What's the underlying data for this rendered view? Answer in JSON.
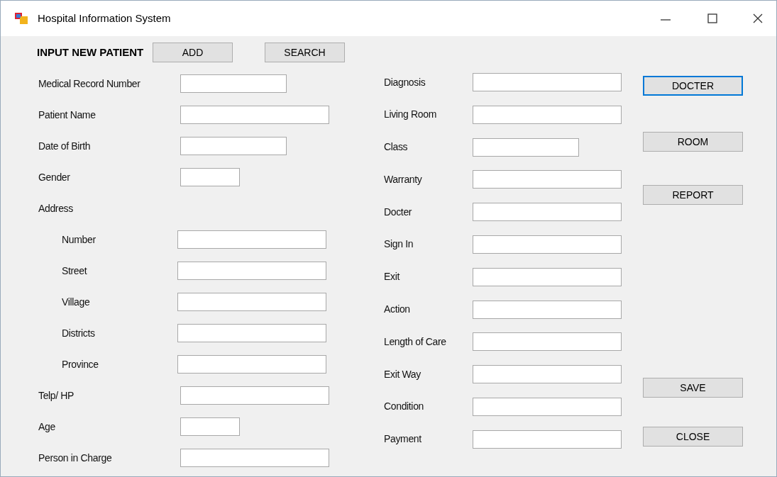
{
  "window": {
    "title": "Hospital Information System"
  },
  "header": {
    "title": "INPUT NEW PATIENT",
    "buttons": [
      "ADD",
      "SEARCH"
    ]
  },
  "left_fields": [
    {
      "label": "Medical Record Number",
      "kind": "medium"
    },
    {
      "label": "Patient Name",
      "kind": "wide"
    },
    {
      "label": "Date of Birth",
      "kind": "medium"
    },
    {
      "label": "Gender",
      "kind": "small"
    },
    {
      "label": "Address",
      "kind": "heading",
      "children": [
        {
          "label": "Number",
          "kind": "wide"
        },
        {
          "label": "Street",
          "kind": "wide"
        },
        {
          "label": "Village",
          "kind": "wide"
        },
        {
          "label": "Districts",
          "kind": "wide"
        },
        {
          "label": "Province",
          "kind": "wide"
        }
      ]
    },
    {
      "label": "Telp/ HP",
      "kind": "wide"
    },
    {
      "label": "Age",
      "kind": "small"
    },
    {
      "label": "Person in Charge",
      "kind": "wide"
    }
  ],
  "right_fields": [
    {
      "label": "Diagnosis",
      "kind": "wide"
    },
    {
      "label": "Living Room",
      "kind": "wide"
    },
    {
      "label": "Class",
      "kind": "medium"
    },
    {
      "label": "Warranty",
      "kind": "wide"
    },
    {
      "label": "Docter",
      "kind": "wide"
    },
    {
      "label": "Sign In",
      "kind": "wide"
    },
    {
      "label": "Exit",
      "kind": "wide"
    },
    {
      "label": "Action",
      "kind": "wide"
    },
    {
      "label": "Length of Care",
      "kind": "wide"
    },
    {
      "label": "Exit Way",
      "kind": "wide"
    },
    {
      "label": "Condition",
      "kind": "wide"
    },
    {
      "label": "Payment",
      "kind": "wide"
    }
  ],
  "side_buttons": [
    {
      "label": "DOCTER",
      "selected": true
    },
    {
      "label": "ROOM",
      "selected": false
    },
    {
      "label": "REPORT",
      "selected": false
    }
  ],
  "action_buttons": [
    {
      "label": "SAVE",
      "selected": false
    },
    {
      "label": "CLOSE",
      "selected": false
    }
  ]
}
